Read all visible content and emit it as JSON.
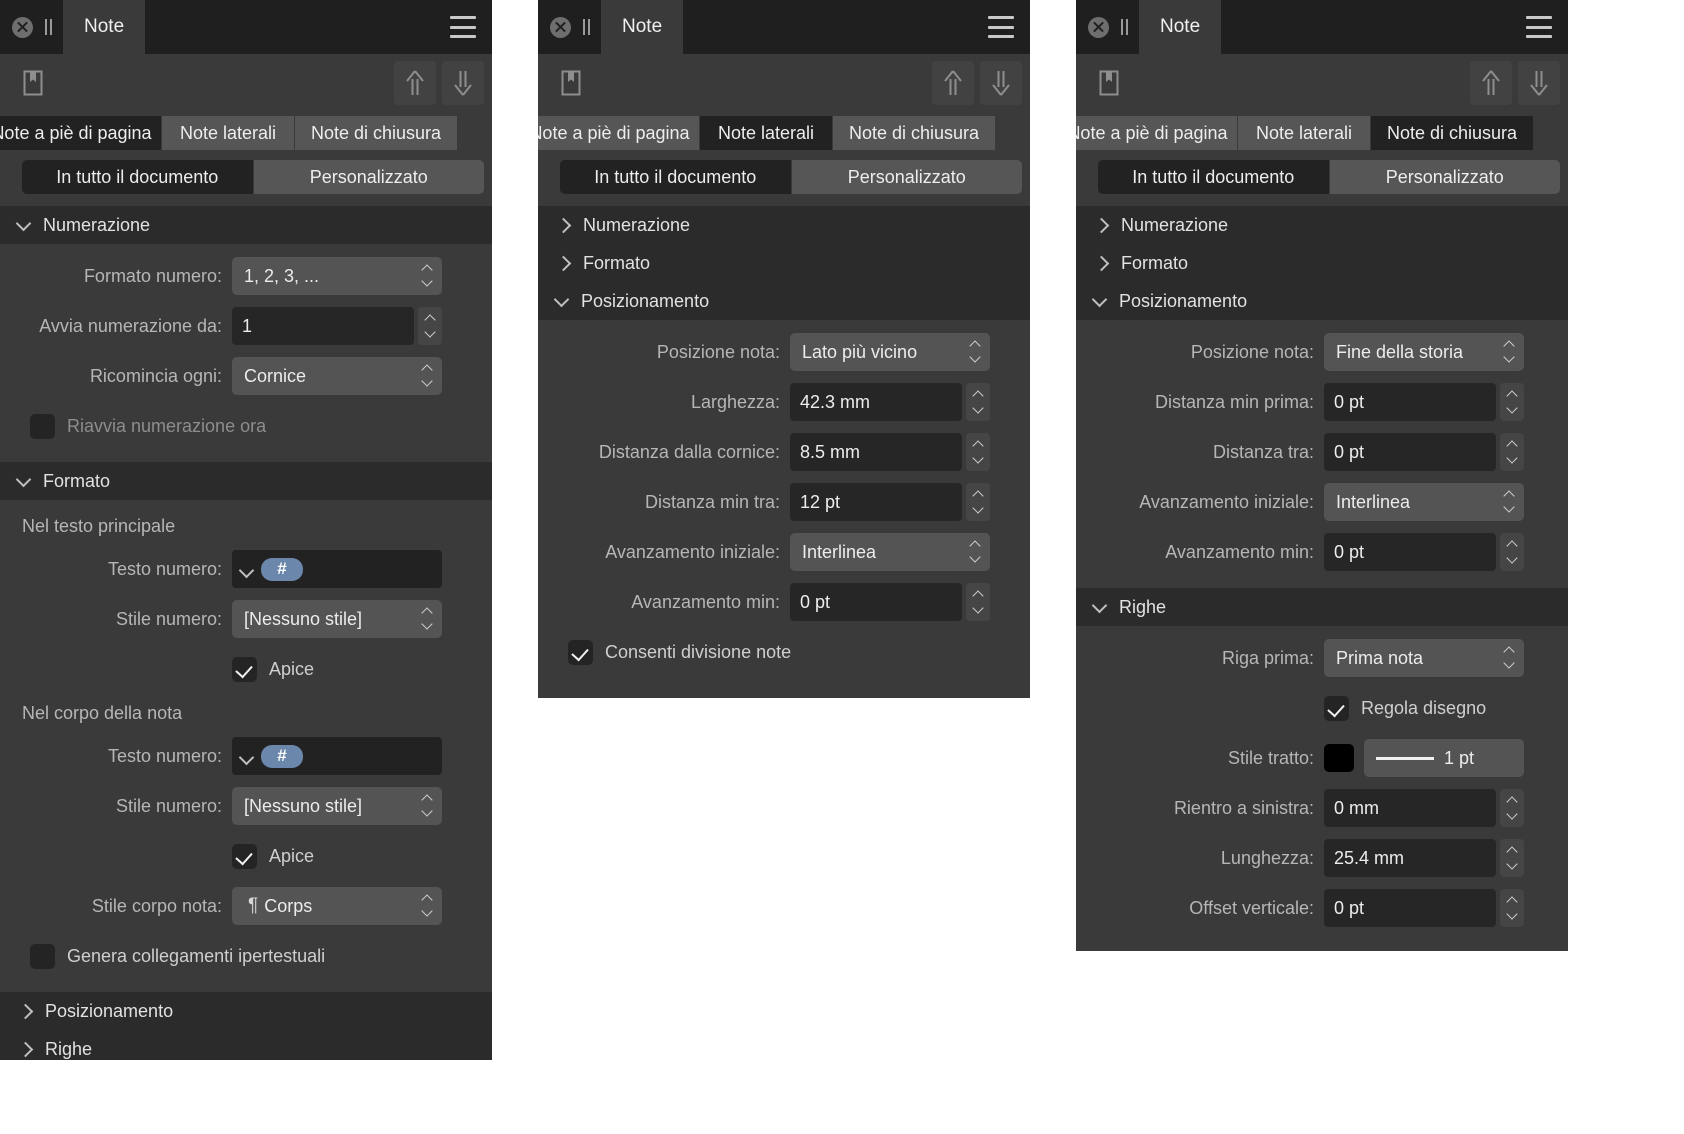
{
  "window": {
    "tab_title": "Note",
    "close_icon": "close-icon",
    "grip_icon": "drag-grip-icon",
    "menu_icon": "hamburger-menu-icon",
    "bookmark_icon": "bookmark-icon",
    "up_icon": "arrow-up-icon",
    "down_icon": "arrow-down-icon"
  },
  "note_kind_tabs": [
    "Note a piè di pagina",
    "Note laterali",
    "Note di chiusura"
  ],
  "scope_tabs": [
    "In tutto il documento",
    "Personalizzato"
  ],
  "colors": {
    "accent_token": "#6b87ab",
    "stroke_color": "#000000",
    "panel_bg": "#3a3a3a",
    "section_header_bg": "#2b2b2b",
    "field_bg": "#262626",
    "popup_bg": "#545454"
  },
  "panels": [
    {
      "id": "footnotes",
      "active_note_kind": "Note a piè di pagina",
      "active_scope": "In tutto il documento",
      "sections": {
        "numerazione": {
          "title": "Numerazione",
          "expanded": true,
          "formato_numero_label": "Formato numero:",
          "formato_numero_value": "1, 2, 3, ...",
          "avvia_numerazione_label": "Avvia numerazione da:",
          "avvia_numerazione_value": "1",
          "ricomincia_ogni_label": "Ricomincia ogni:",
          "ricomincia_ogni_value": "Cornice",
          "riavvia_label": "Riavvia numerazione ora",
          "riavvia_checked": false
        },
        "formato": {
          "title": "Formato",
          "expanded": true,
          "group_main_text": "Nel testo principale",
          "group_note_body": "Nel corpo della nota",
          "testo_numero_label": "Testo numero:",
          "testo_numero_token": "#",
          "stile_numero_label": "Stile numero:",
          "stile_numero_value": "[Nessuno stile]",
          "apice_label": "Apice",
          "apice_main_checked": true,
          "apice_body_checked": true,
          "stile_corpo_label": "Stile corpo nota:",
          "stile_corpo_value": "Corps",
          "stile_corpo_icon": "pilcrow-icon",
          "hyperlink_label": "Genera collegamenti ipertestuali",
          "hyperlink_checked": false
        },
        "posizionamento": {
          "title": "Posizionamento",
          "expanded": false
        },
        "righe": {
          "title": "Righe",
          "expanded": false
        }
      }
    },
    {
      "id": "sidenotes",
      "active_note_kind": "Note laterali",
      "active_scope": "In tutto il documento",
      "sections": {
        "numerazione": {
          "title": "Numerazione",
          "expanded": false
        },
        "formato": {
          "title": "Formato",
          "expanded": false
        },
        "posizionamento": {
          "title": "Posizionamento",
          "expanded": true,
          "rows": [
            {
              "label": "Posizione nota:",
              "value": "Lato più vicino",
              "kind": "popup"
            },
            {
              "label": "Larghezza:",
              "value": "42.3 mm",
              "kind": "stepper"
            },
            {
              "label": "Distanza dalla cornice:",
              "value": "8.5 mm",
              "kind": "stepper"
            },
            {
              "label": "Distanza min tra:",
              "value": "12 pt",
              "kind": "stepper"
            },
            {
              "label": "Avanzamento iniziale:",
              "value": "Interlinea",
              "kind": "popup"
            },
            {
              "label": "Avanzamento min:",
              "value": "0 pt",
              "kind": "stepper"
            }
          ],
          "consenti_divisione_label": "Consenti divisione note",
          "consenti_divisione_checked": true
        }
      }
    },
    {
      "id": "endnotes",
      "active_note_kind": "Note di chiusura",
      "active_scope": "In tutto il documento",
      "sections": {
        "numerazione": {
          "title": "Numerazione",
          "expanded": false
        },
        "formato": {
          "title": "Formato",
          "expanded": false
        },
        "posizionamento": {
          "title": "Posizionamento",
          "expanded": true,
          "rows": [
            {
              "label": "Posizione nota:",
              "value": "Fine della storia",
              "kind": "popup"
            },
            {
              "label": "Distanza min prima:",
              "value": "0 pt",
              "kind": "stepper"
            },
            {
              "label": "Distanza tra:",
              "value": "0 pt",
              "kind": "stepper"
            },
            {
              "label": "Avanzamento iniziale:",
              "value": "Interlinea",
              "kind": "popup"
            },
            {
              "label": "Avanzamento min:",
              "value": "0 pt",
              "kind": "stepper"
            }
          ]
        },
        "righe": {
          "title": "Righe",
          "expanded": true,
          "riga_prima_label": "Riga prima:",
          "riga_prima_value": "Prima nota",
          "regola_disegno_label": "Regola disegno",
          "regola_disegno_checked": true,
          "stile_tratto_label": "Stile tratto:",
          "stile_tratto_width": "1 pt",
          "rientro_label": "Rientro a sinistra:",
          "rientro_value": "0 mm",
          "lunghezza_label": "Lunghezza:",
          "lunghezza_value": "25.4 mm",
          "offset_label": "Offset verticale:",
          "offset_value": "0 pt"
        }
      }
    }
  ]
}
